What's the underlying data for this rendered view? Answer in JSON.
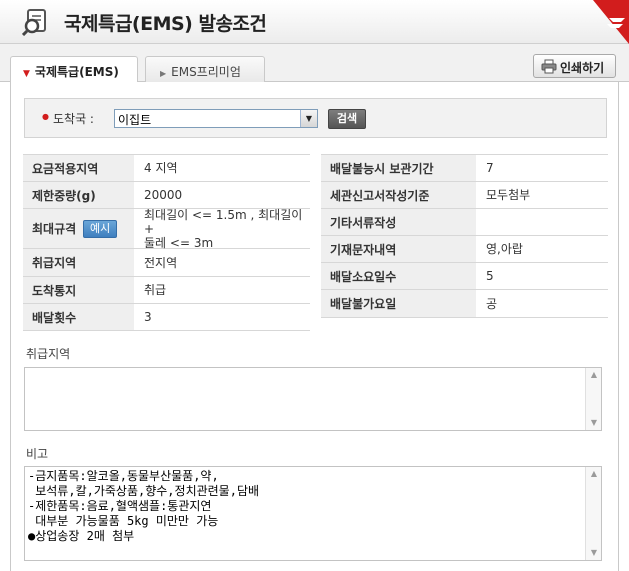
{
  "header": {
    "title": "국제특급(EMS) 발송조건"
  },
  "tabs": [
    {
      "label": "국제특급(EMS)",
      "active": true
    },
    {
      "label": "EMS프리미엄",
      "active": false
    }
  ],
  "toolbar": {
    "print_label": "인쇄하기"
  },
  "search": {
    "destination_label": "도착국 :",
    "selected_country": "이집트",
    "search_button": "검색"
  },
  "left_table": {
    "rows": [
      {
        "label": "요금적용지역",
        "value": "4 지역"
      },
      {
        "label": "제한중량(g)",
        "value": "20000"
      },
      {
        "label": "최대규격",
        "button": "예시",
        "value_line1": "최대길이 <= 1.5m , 최대길이+",
        "value_line2": "둘레 <= 3m"
      },
      {
        "label": "취급지역",
        "value": "전지역"
      },
      {
        "label": "도착통지",
        "value": "취급"
      },
      {
        "label": "배달횟수",
        "value": "3"
      }
    ]
  },
  "right_table": {
    "rows": [
      {
        "label": "배달불능시 보관기간",
        "value": "7"
      },
      {
        "label": "세관신고서작성기준",
        "value": "모두첨부"
      },
      {
        "label": "기타서류작성",
        "value": ""
      },
      {
        "label": "기재문자내역",
        "value": "영,아랍"
      },
      {
        "label": "배달소요일수",
        "value": "5"
      },
      {
        "label": "배달불가요일",
        "value": "공"
      }
    ]
  },
  "handling_area": {
    "label": "취급지역",
    "content": ""
  },
  "remarks": {
    "label": "비고",
    "lines": [
      "-금지품목:알코올,동물부산물품,약,",
      " 보석류,칼,가죽상품,향수,정치관련물,담배",
      "-제한품목:음료,혈액샘플:통관지연",
      " 대부분 가능물품 5kg 미만만 가능",
      "●상업송장 2매 첨부"
    ]
  },
  "colors": {
    "accent_red": "#d21d1d",
    "header_gray": "#efefef",
    "button_blue": "#3f7fbf"
  }
}
